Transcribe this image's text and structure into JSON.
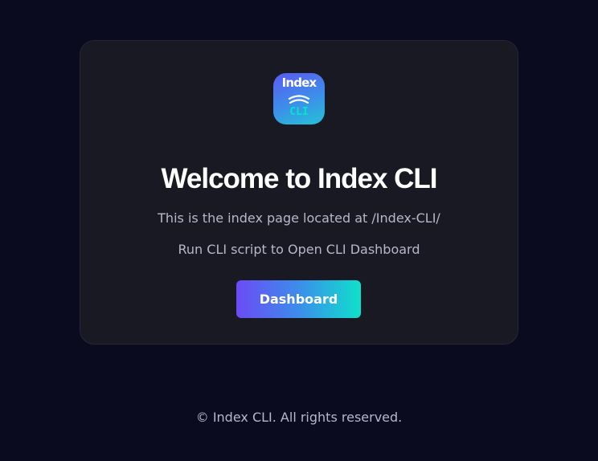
{
  "logo": {
    "top_text": "Index",
    "bottom_text": "CLI",
    "icon": "index-cli-logo-icon",
    "colors": {
      "gradient_start": "#5a5af5",
      "gradient_mid": "#3d8ee9",
      "gradient_end": "#22c4d8",
      "top_text": "#ffffff",
      "bottom_text": "#00e8c9"
    }
  },
  "welcome": {
    "title": "Welcome to Index CLI",
    "location_text": "This is the index page located at /Index-CLI/",
    "instruction_text": "Run CLI script to Open CLI Dashboard"
  },
  "actions": {
    "dashboard_label": "Dashboard",
    "gradient": [
      "#6b4bf5",
      "#3c8deb",
      "#0fe0cc"
    ]
  },
  "footer": {
    "text": "© Index CLI. All rights reserved."
  },
  "colors": {
    "page_background": "#0a0b1f",
    "card_background": "#191923",
    "card_border": "#262637",
    "title": "#ffffff",
    "body_text": "#b7b7cc"
  }
}
